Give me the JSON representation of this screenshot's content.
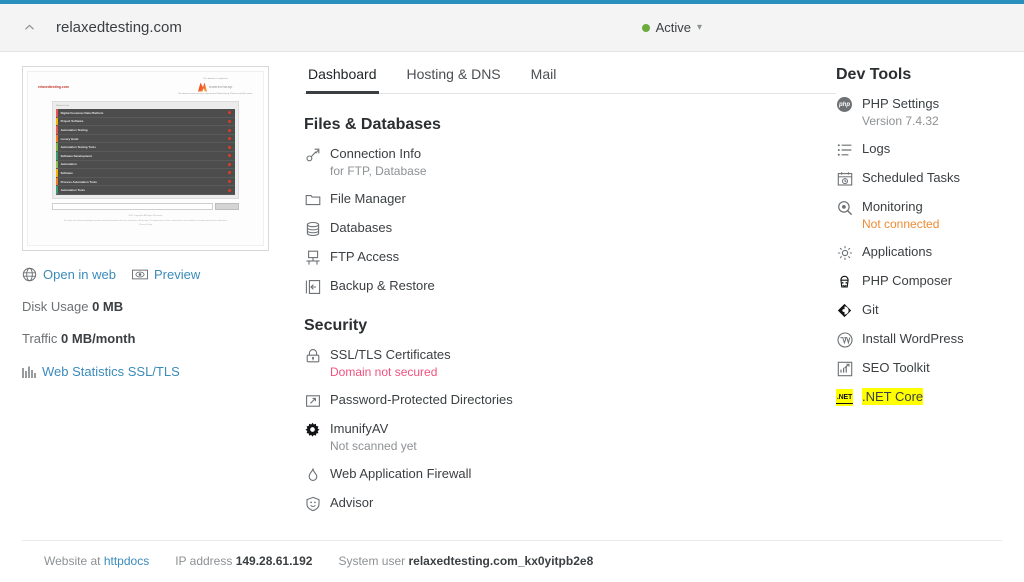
{
  "header": {
    "collapse_icon": "chevron-up-icon",
    "domain": "relaxedtesting.com",
    "status": "Active",
    "status_color": "#6aab3c",
    "status_caret": "chevron-down-icon"
  },
  "accent": {
    "topbar": "#2a8fbd",
    "link": "#3a8bba",
    "danger": "#f0527f",
    "warn": "#ef8a33",
    "highlight": "#ffff00"
  },
  "preview": {
    "domain_label": "relaxedtesting.com",
    "brand_caption_top": "This domain is registered",
    "brand_name": "namecheap",
    "brand_caption_bottom": "This domain name recently registered at Namecheap.\nPlease send the owner.",
    "panel_caption": "Related Links",
    "rows": [
      {
        "label": "Digital Customer Data Platform",
        "bar": "#e8554d"
      },
      {
        "label": "Project Software",
        "bar": "#f5b301"
      },
      {
        "label": "Automation Testing",
        "bar": "#e8554d"
      },
      {
        "label": "Luxury Hotel",
        "bar": "#f07d1d"
      },
      {
        "label": "Automation Testing Tools",
        "bar": "#7cb342"
      },
      {
        "label": "Software Development",
        "bar": "#3d9970"
      },
      {
        "label": "Automation",
        "bar": "#8bc34a"
      },
      {
        "label": "Software",
        "bar": "#f5b301"
      },
      {
        "label": "Process Automation Tools",
        "bar": "#f07d1d"
      },
      {
        "label": "Automation Tools",
        "bar": "#3d9970"
      }
    ],
    "search_button": "Search",
    "footer_copyright": "2022 Copyright. All Rights Reserved.",
    "footer_disclaimer": "This web site contains displayed content and advertisements that are served by a third party. The appearance of the content does not constitute an endorsement by the advertiser.",
    "footer_link": "Privacy Policy"
  },
  "left": {
    "open_in_web": {
      "label": "Open in web",
      "icon": "globe-icon"
    },
    "preview": {
      "label": "Preview",
      "icon": "eye-icon"
    },
    "disk_usage": {
      "label": "Disk Usage",
      "value": "0 MB"
    },
    "traffic": {
      "label": "Traffic",
      "value": "0 MB/month"
    },
    "web_statistics": {
      "label": "Web Statistics SSL/TLS",
      "icon": "bar-chart-icon"
    }
  },
  "tabs": [
    {
      "label": "Dashboard",
      "active": true
    },
    {
      "label": "Hosting & DNS",
      "active": false
    },
    {
      "label": "Mail",
      "active": false
    }
  ],
  "files_databases": {
    "title": "Files & Databases",
    "items": [
      {
        "label": "Connection Info",
        "sub": "for FTP, Database",
        "sub_style": "muted",
        "icon": "connection-icon"
      },
      {
        "label": "File Manager",
        "sub": "",
        "icon": "folder-icon"
      },
      {
        "label": "Databases",
        "sub": "",
        "icon": "database-icon"
      },
      {
        "label": "FTP Access",
        "sub": "",
        "icon": "monitor-icon"
      },
      {
        "label": "Backup & Restore",
        "sub": "",
        "icon": "backup-icon"
      }
    ]
  },
  "security": {
    "title": "Security",
    "items": [
      {
        "label": "SSL/TLS Certificates",
        "sub": "Domain not secured",
        "sub_style": "danger",
        "icon": "lock-icon"
      },
      {
        "label": "Password-Protected Directories",
        "sub": "",
        "icon": "key-folder-icon"
      },
      {
        "label": "ImunifyAV",
        "sub": "Not scanned yet",
        "sub_style": "muted",
        "icon": "gear-solid-icon"
      },
      {
        "label": "Web Application Firewall",
        "sub": "",
        "icon": "flame-icon"
      },
      {
        "label": "Advisor",
        "sub": "",
        "icon": "advisor-icon"
      }
    ]
  },
  "dev_tools": {
    "title": "Dev Tools",
    "items": [
      {
        "label": "PHP Settings",
        "sub": "Version 7.4.32",
        "sub_style": "muted",
        "icon": "php-icon",
        "highlighted": false
      },
      {
        "label": "Logs",
        "sub": "",
        "icon": "list-icon",
        "highlighted": false
      },
      {
        "label": "Scheduled Tasks",
        "sub": "",
        "icon": "calendar-clock-icon",
        "highlighted": false
      },
      {
        "label": "Monitoring",
        "sub": "Not connected",
        "sub_style": "warn",
        "icon": "magnifier-icon",
        "highlighted": false
      },
      {
        "label": "Applications",
        "sub": "",
        "icon": "gear-icon",
        "highlighted": false
      },
      {
        "label": "PHP Composer",
        "sub": "",
        "icon": "composer-icon",
        "highlighted": false
      },
      {
        "label": "Git",
        "sub": "",
        "icon": "git-icon",
        "highlighted": false
      },
      {
        "label": "Install WordPress",
        "sub": "",
        "icon": "wordpress-icon",
        "highlighted": false
      },
      {
        "label": "SEO Toolkit",
        "sub": "",
        "icon": "seo-chart-icon",
        "highlighted": false
      },
      {
        "label": ".NET Core",
        "sub": "",
        "icon": "dotnet-icon",
        "icon_text": ".NET",
        "highlighted": true
      }
    ]
  },
  "footer": {
    "website_label": "Website at",
    "website_link": "httpdocs",
    "ip_label": "IP address",
    "ip_value": "149.28.61.192",
    "user_label": "System user",
    "user_value": "relaxedtesting.com_kx0yitpb2e8"
  }
}
